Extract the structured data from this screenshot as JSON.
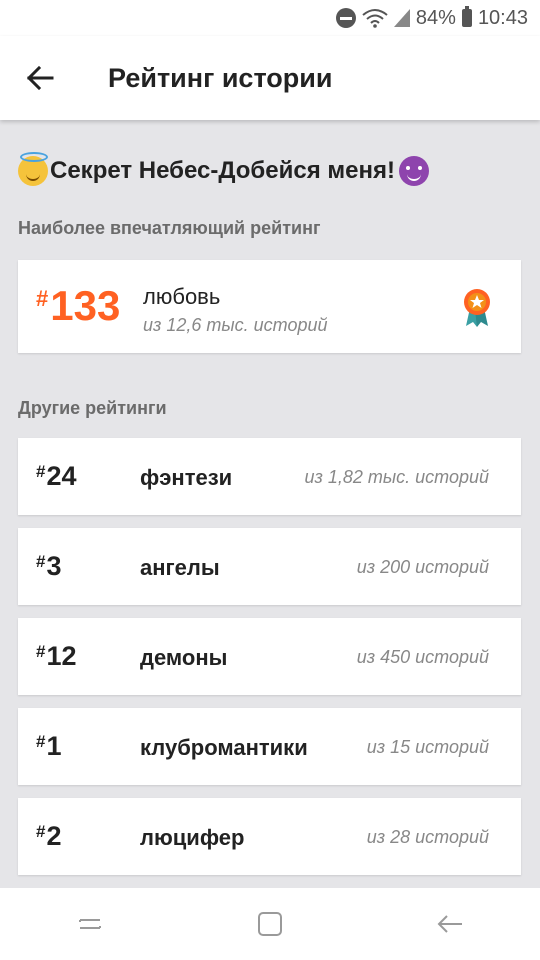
{
  "status_bar": {
    "battery": "84%",
    "time": "10:43"
  },
  "app_bar": {
    "title": "Рейтинг истории"
  },
  "story": {
    "title": "Секрет Небес-Добейся меня!"
  },
  "featured": {
    "label": "Наиболее впечатляющий рейтинг",
    "hash": "#",
    "rank": "133",
    "tag": "любовь",
    "count": "из 12,6 тыс. историй",
    "accent_color": "#ff6122"
  },
  "others": {
    "label": "Другие рейтинги",
    "items": [
      {
        "hash": "#",
        "rank": "24",
        "tag": "фэнтези",
        "count": "из 1,82 тыс. историй"
      },
      {
        "hash": "#",
        "rank": "3",
        "tag": "ангелы",
        "count": "из 200 историй"
      },
      {
        "hash": "#",
        "rank": "12",
        "tag": "демоны",
        "count": "из 450 историй"
      },
      {
        "hash": "#",
        "rank": "1",
        "tag": "клубромантики",
        "count": "из 15 историй"
      },
      {
        "hash": "#",
        "rank": "2",
        "tag": "люцифер",
        "count": "из 28 историй"
      }
    ]
  },
  "icons": {
    "back": "arrow-left-icon",
    "award": "award-ribbon-icon",
    "nav_recent": "recent-apps-icon",
    "nav_home": "home-icon",
    "nav_back": "back-icon"
  }
}
